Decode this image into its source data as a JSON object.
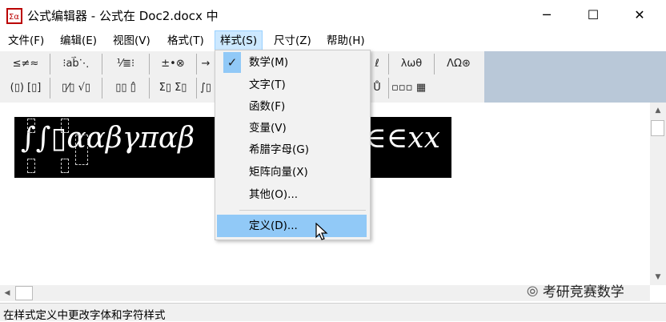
{
  "window": {
    "title": "公式编辑器 - 公式在 Doc2.docx 中",
    "minimize": "─",
    "maximize": "☐",
    "close": "✕"
  },
  "menubar": [
    {
      "label": "文件(F)"
    },
    {
      "label": "编辑(E)"
    },
    {
      "label": "视图(V)"
    },
    {
      "label": "格式(T)"
    },
    {
      "label": "样式(S)"
    },
    {
      "label": "尺寸(Z)"
    },
    {
      "label": "帮助(H)"
    }
  ],
  "toolbar": {
    "row1": [
      "≤≠≈",
      "⁝ab⃑⋱",
      "⅟≣⁝",
      "±•⊗",
      "→",
      "ℓ",
      "λωθ",
      "ΛΩ⊛"
    ],
    "row2": [
      "(▯) [▯]",
      "▯⁄▯ √▯",
      "▯▯ ▯̂",
      "Σ▯ Σ▯",
      "∫▯",
      "Ů",
      "▫▫▫",
      "▦"
    ]
  },
  "equation": {
    "text": "∫∫▯ααβγπαβ",
    "tail": "∈∈xx"
  },
  "style_menu": {
    "items": [
      {
        "label": "数学(M)",
        "checked": true
      },
      {
        "label": "文字(T)"
      },
      {
        "label": "函数(F)"
      },
      {
        "label": "变量(V)"
      },
      {
        "label": "希腊字母(G)"
      },
      {
        "label": "矩阵向量(X)"
      },
      {
        "label": "其他(O)..."
      },
      {
        "label": "定义(D)...",
        "highlighted": true
      }
    ],
    "check_glyph": "✓"
  },
  "statusbar": {
    "text": "在样式定义中更改字体和字符样式"
  },
  "watermark": {
    "text": "考研竞赛数学"
  },
  "colors": {
    "menu_highlight": "#91c9f7",
    "menubar_active": "#cce8ff",
    "equation_bg": "#000000"
  }
}
